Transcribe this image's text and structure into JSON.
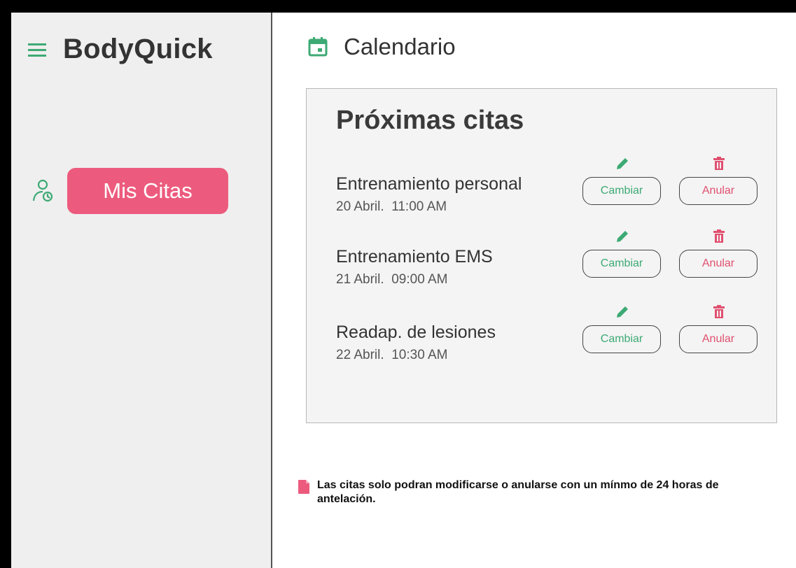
{
  "app": {
    "name": "BodyQuick"
  },
  "sidebar": {
    "items": [
      {
        "label": "Mis Citas",
        "icon": "user-clock-icon",
        "active": true
      }
    ]
  },
  "header": {
    "title": "Calendario",
    "icon": "calendar-icon"
  },
  "appointments_card": {
    "title": "Próximas citas",
    "items": [
      {
        "name": "Entrenamiento personal",
        "date": "20 Abril.  11:00 AM",
        "change_label": "Cambiar",
        "cancel_label": "Anular"
      },
      {
        "name": "Entrenamiento EMS",
        "date": "21 Abril.  09:00 AM",
        "change_label": "Cambiar",
        "cancel_label": "Anular"
      },
      {
        "name": "Readap. de lesiones",
        "date": "22 Abril.  10:30 AM",
        "change_label": "Cambiar",
        "cancel_label": "Anular"
      }
    ]
  },
  "notice": {
    "text": "Las citas solo podran modificarse o anularse con un mínmo de 24 horas de antelación.",
    "icon": "document-icon"
  },
  "colors": {
    "accent_green": "#3daa74",
    "accent_pink": "#ec5b7d",
    "text_dark": "#333333",
    "sidebar_bg": "#efefef"
  }
}
